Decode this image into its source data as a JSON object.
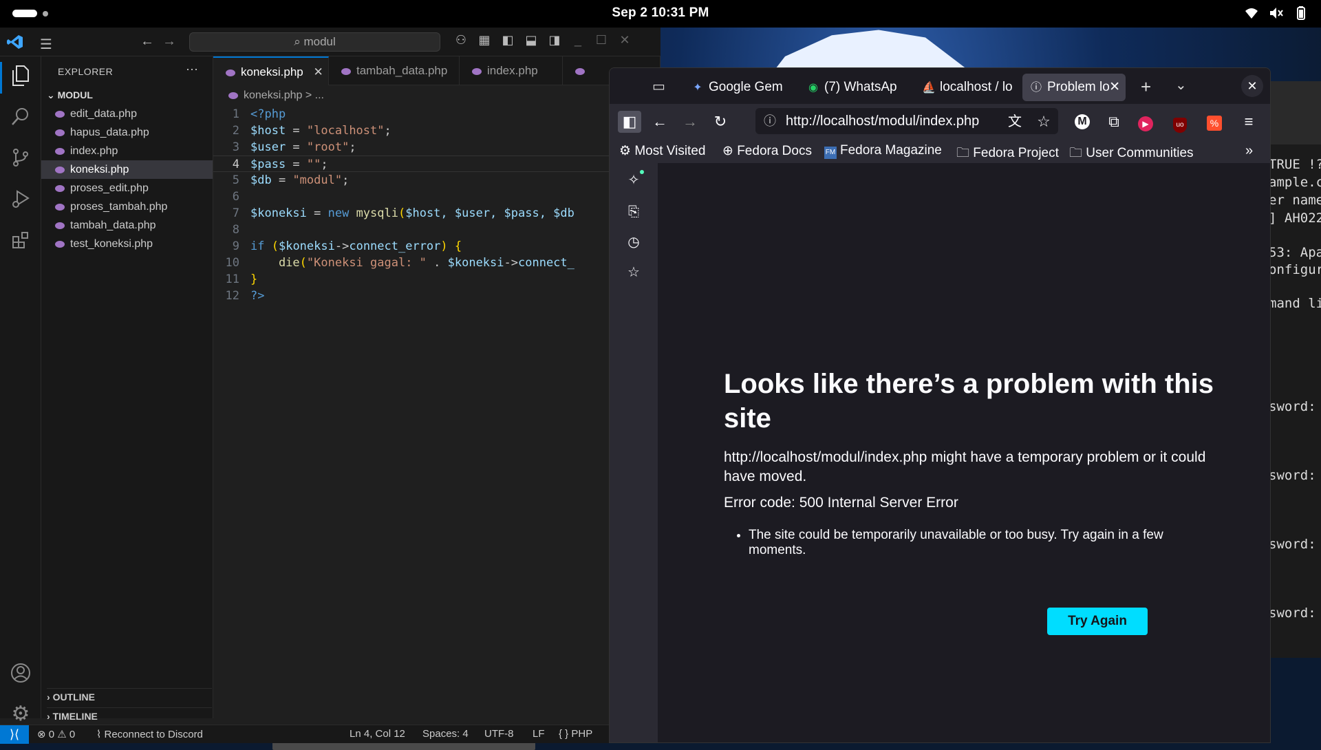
{
  "topbar": {
    "clock": "Sep 2  10:31 PM",
    "icons": [
      "wifi-icon",
      "volume-muted-icon",
      "battery-icon"
    ]
  },
  "vscode": {
    "search_text": "⌕ modul",
    "explorer_title": "EXPLORER",
    "folder": "MODUL",
    "files": [
      "edit_data.php",
      "hapus_data.php",
      "index.php",
      "koneksi.php",
      "proses_edit.php",
      "proses_tambah.php",
      "tambah_data.php",
      "test_koneksi.php"
    ],
    "active_file": "koneksi.php",
    "tabs": [
      {
        "label": "koneksi.php",
        "close": "✕"
      },
      {
        "label": "tambah_data.php"
      },
      {
        "label": "index.php"
      }
    ],
    "breadcrumb": "koneksi.php > ...",
    "line_numbers": [
      "1",
      "2",
      "3",
      "4",
      "5",
      "6",
      "7",
      "8",
      "9",
      "10",
      "11",
      "12"
    ],
    "code": {
      "l1": "<?php",
      "l2_var": "$host",
      "l2_eq": " = ",
      "l2_str": "\"localhost\"",
      "l2_end": ";",
      "l3_var": "$user",
      "l3_eq": " = ",
      "l3_str": "\"root\"",
      "l3_end": ";",
      "l4_var": "$pass",
      "l4_eq": " = ",
      "l4_str": "\"\"",
      "l4_end": ";",
      "l5_var": "$db",
      "l5_eq": " = ",
      "l5_str": "\"modul\"",
      "l5_end": ";",
      "l7_var": "$koneksi",
      "l7_eq": " = ",
      "l7_new": "new",
      "l7_fn": " mysqli",
      "l7_p": "(",
      "l7_args": "$host, $user, $pass, $db",
      "l9_if": "if",
      "l9_p": " (",
      "l9_var": "$koneksi",
      "l9_arrow": "->",
      "l9_prop": "connect_error",
      "l9_end": ") {",
      "l10_fn": "    die",
      "l10_p": "(",
      "l10_str": "\"Koneksi gagal: \"",
      "l10_dot": " . ",
      "l10_var": "$koneksi",
      "l10_arrow": "->",
      "l10_prop": "connect_",
      "l11": "}",
      "l12": "?>"
    },
    "outline": "OUTLINE",
    "timeline": "TIMELINE",
    "status": {
      "errors": "⊗ 0 ⚠ 0",
      "discord": "Reconnect to Discord",
      "position": "Ln 4, Col 12",
      "spaces": "Spaces: 4",
      "encoding": "UTF-8",
      "eol": "LF",
      "language": "{ } PHP"
    }
  },
  "firefox": {
    "tabs": [
      {
        "label": "Google Gem",
        "icon": "gemini-icon"
      },
      {
        "label": "(7) WhatsAp",
        "icon": "whatsapp-icon"
      },
      {
        "label": "localhost / lo",
        "icon": "phpmyadmin-icon"
      },
      {
        "label": "Problem lo",
        "icon": "info-icon"
      }
    ],
    "url": "http://localhost/modul/index.php",
    "bookmarks": [
      "Most Visited",
      "Fedora Docs",
      "Fedora Magazine",
      "Fedora Project",
      "User Communities"
    ],
    "error": {
      "title": "Looks like there’s a problem with this site",
      "description": "http://localhost/modul/index.php might have a temporary problem or it could have moved.",
      "code": "Error code: 500 Internal Server Error",
      "bullet": "The site could be temporarily unavailable or too busy. Try again in a few moments.",
      "button": "Try Again"
    }
  },
  "terminal": {
    "lines": [
      "TRUE !?",
      "ample.c",
      "er name",
      "] AH022",
      "",
      "53: Apa",
      "onfigur",
      "",
      "mand li",
      "sword:",
      "sword:",
      "sword:",
      "sword:"
    ]
  },
  "colors": {
    "accent": "#0078d4",
    "button": "#00ddff",
    "php": "#a074c4"
  }
}
